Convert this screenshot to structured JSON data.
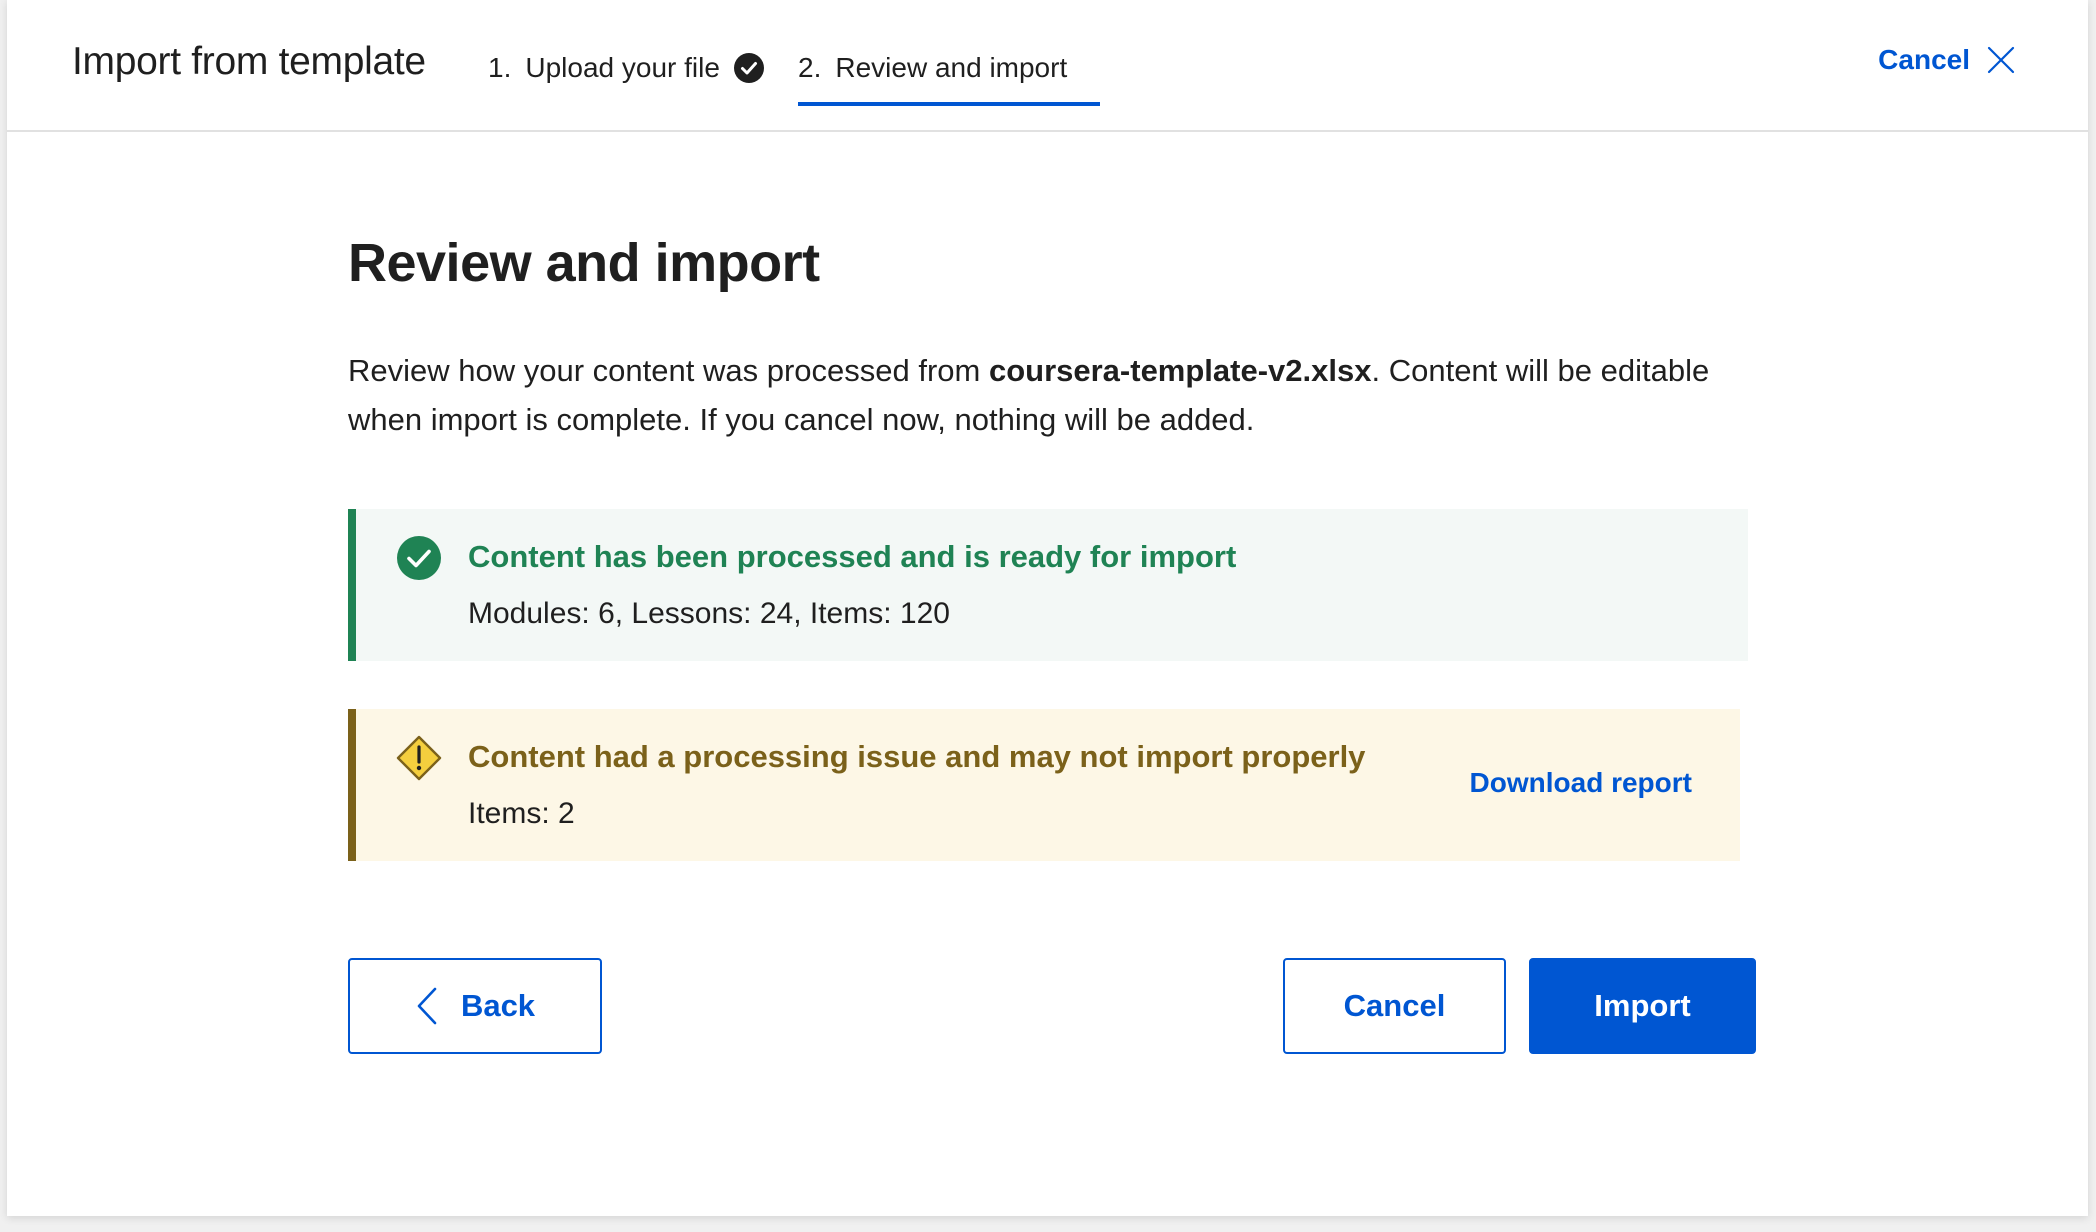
{
  "header": {
    "title": "Import from template",
    "steps": [
      {
        "number": "1.",
        "label": "Upload your file",
        "status": "complete",
        "icon": "check-circle-icon"
      },
      {
        "number": "2.",
        "label": "Review and import",
        "status": "active"
      }
    ],
    "cancel_label": "Cancel",
    "close_icon": "close-icon"
  },
  "main": {
    "title": "Review and import",
    "description": {
      "before": "Review how your content was processed from ",
      "filename": "coursera-template-v2.xlsx",
      "after": ". Content will be editable when import is complete. If you cancel now, nothing will be added."
    },
    "success_alert": {
      "icon": "check-circle-icon",
      "title": "Content has been processed and is ready for import",
      "detail": "Modules: 6, Lessons: 24, Items: 120"
    },
    "warning_alert": {
      "icon": "warning-icon",
      "title": "Content had a processing issue and may not import properly",
      "detail": "Items: 2",
      "link_label": "Download report"
    },
    "buttons": {
      "back_label": "Back",
      "cancel_label": "Cancel",
      "import_label": "Import"
    }
  },
  "colors": {
    "primary": "#0056d2",
    "success": "#1f8354",
    "success_bg": "#f3f8f6",
    "warning": "#7b611a",
    "warning_bg": "#fdf7e6",
    "warning_icon": "#f4ce3e"
  }
}
